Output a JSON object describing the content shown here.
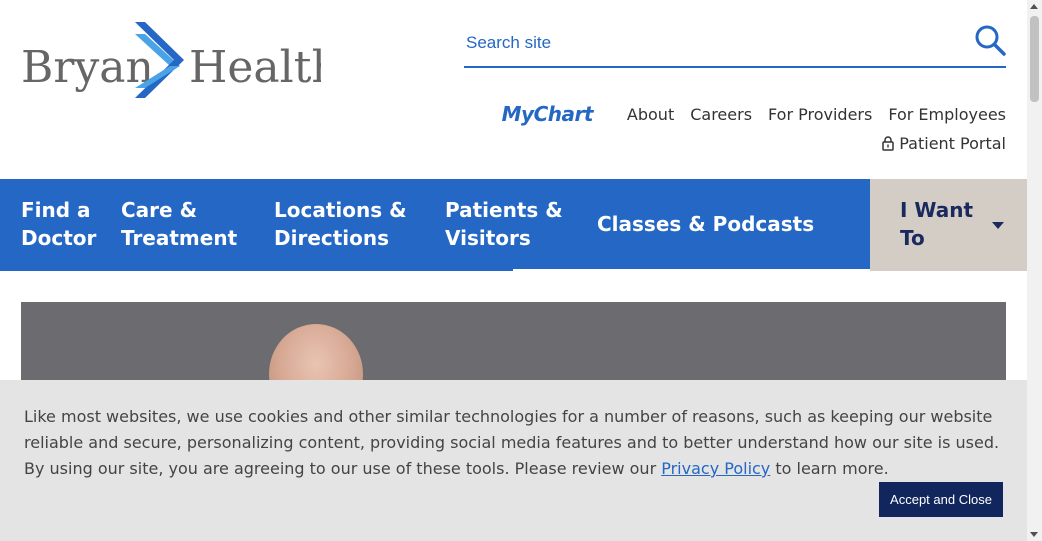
{
  "brand": {
    "name_left": "Bryan",
    "name_right": "Health",
    "logo_colors": {
      "text": "#666666",
      "chevron_dark": "#2467c4",
      "chevron_light": "#4aa3e6"
    }
  },
  "search": {
    "placeholder": "Search site",
    "icon": "search-icon"
  },
  "utility_nav": {
    "mychart": "MyChart",
    "links": [
      "About",
      "Careers",
      "For Providers",
      "For Employees"
    ],
    "patient_portal": "Patient Portal",
    "patient_portal_icon": "lock-icon"
  },
  "main_nav": {
    "items": [
      {
        "line1": "Find a",
        "line2": "Doctor"
      },
      {
        "line1": "Care &",
        "line2": "Treatment"
      },
      {
        "line1": "Locations &",
        "line2": "Directions"
      },
      {
        "line1": "Patients &",
        "line2": "Visitors"
      },
      {
        "line1": "Classes & Podcasts",
        "line2": ""
      }
    ],
    "i_want_to": {
      "line1": "I Want",
      "line2": "To",
      "icon": "caret-down-icon"
    },
    "colors": {
      "nav_bg": "#2467c4",
      "i_want_bg": "#d3cdc6",
      "i_want_text": "#1b2a5e"
    }
  },
  "cookie_banner": {
    "text_before": "Like most websites, we use cookies and other similar technologies for a number of reasons, such as keeping our website reliable and secure, personalizing content, providing social media features and to better understand how our site is used. By using our site, you are agreeing to our use of these tools. Please review our ",
    "link_text": "Privacy Policy",
    "text_after": " to learn more.",
    "accept_label": "Accept and Close",
    "colors": {
      "bg": "#e4e4e4",
      "button_bg": "#10265c"
    }
  }
}
